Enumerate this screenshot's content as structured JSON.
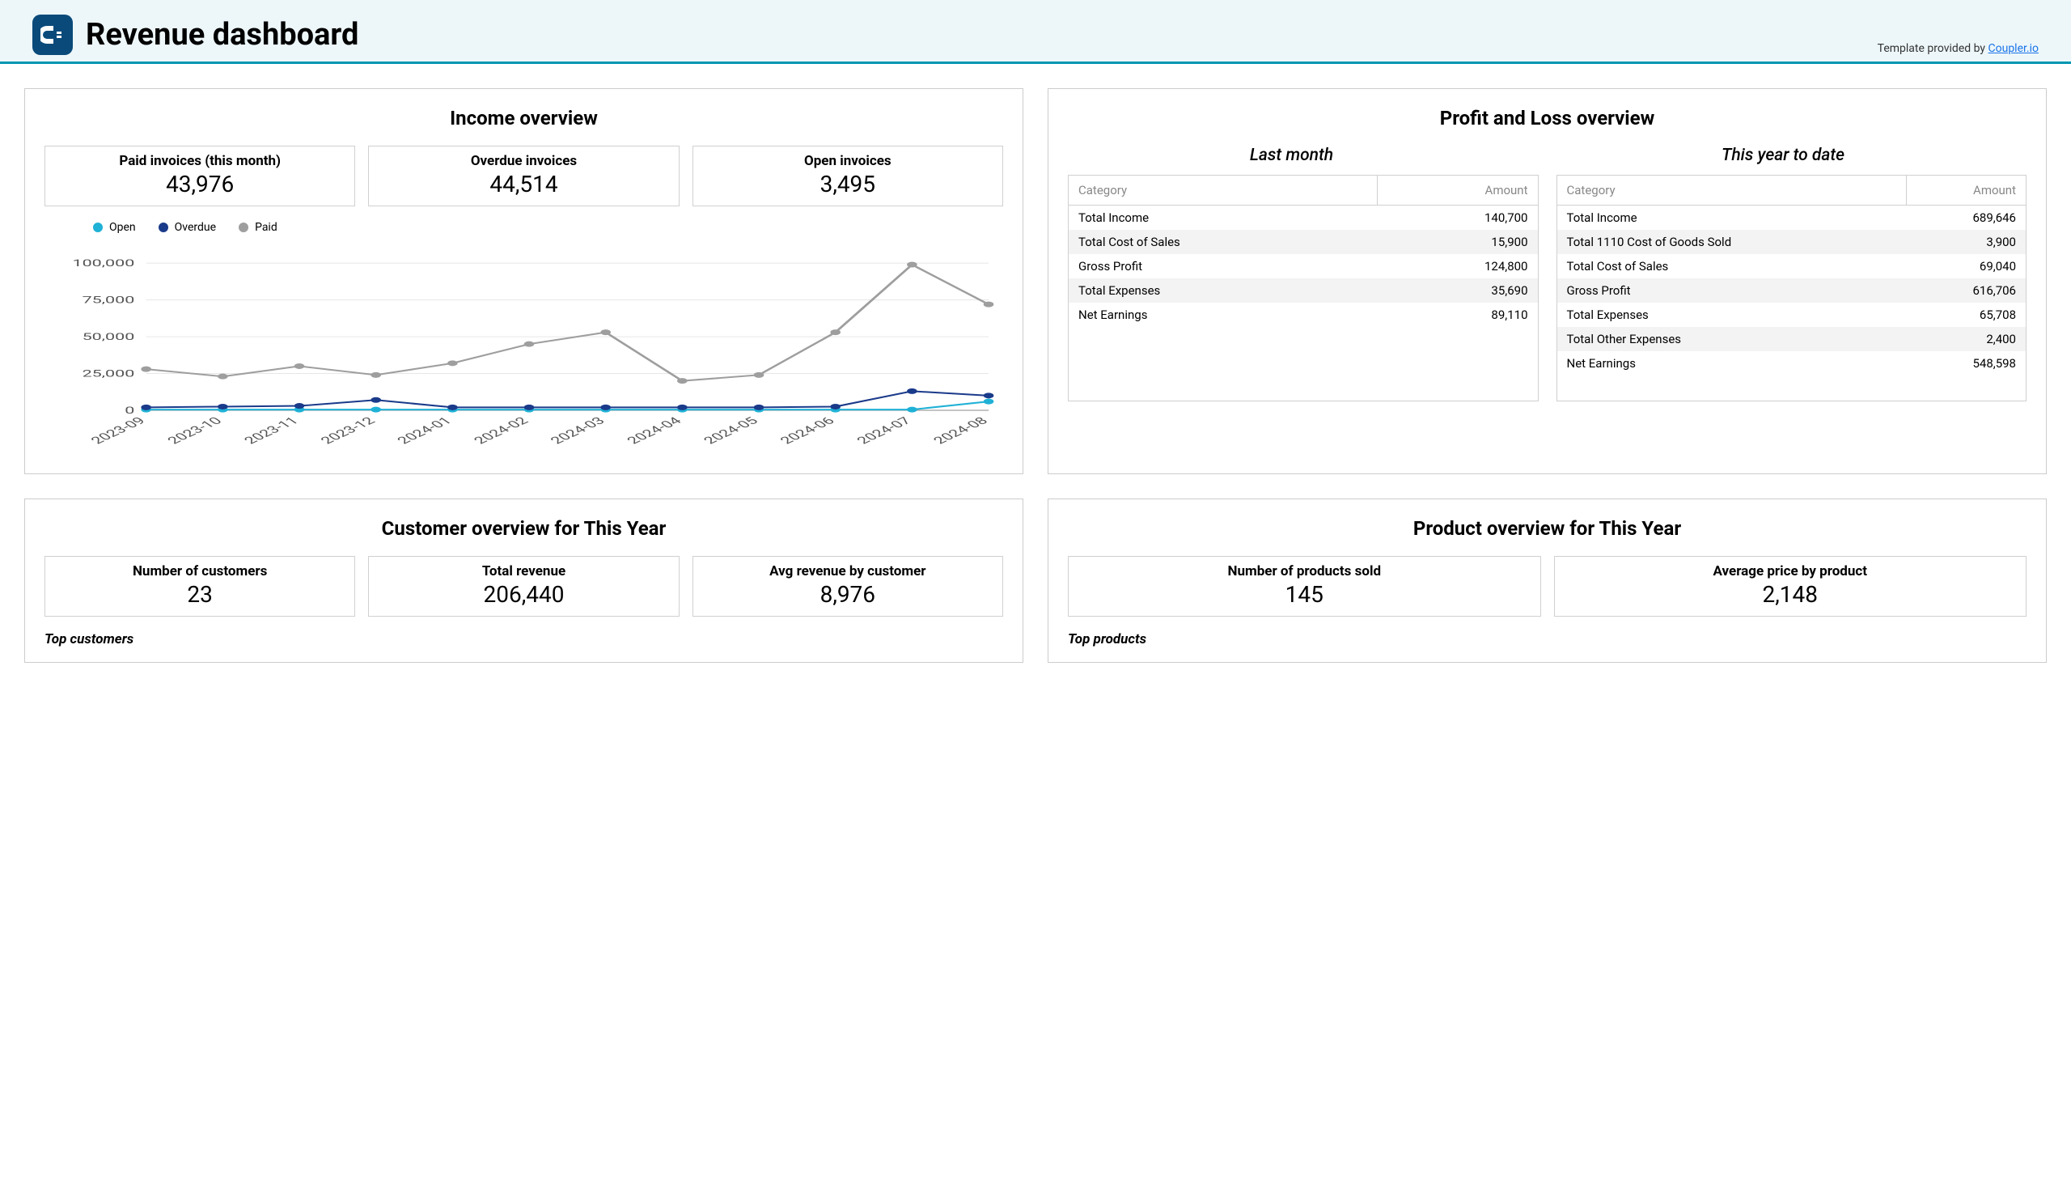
{
  "header": {
    "title": "Revenue dashboard",
    "template_text": "Template provided by ",
    "template_link": "Coupler.io"
  },
  "income": {
    "title": "Income overview",
    "stats": [
      {
        "label": "Paid invoices (this month)",
        "value": "43,976"
      },
      {
        "label": "Overdue invoices",
        "value": "44,514"
      },
      {
        "label": "Open invoices",
        "value": "3,495"
      }
    ],
    "legend": {
      "open": "Open",
      "overdue": "Overdue",
      "paid": "Paid"
    }
  },
  "chart_data": {
    "type": "line",
    "title": "Income overview",
    "xlabel": "",
    "ylabel": "",
    "ylim": [
      0,
      110000
    ],
    "yticks": [
      0,
      25000,
      50000,
      75000,
      100000
    ],
    "ytick_labels": [
      "0",
      "25,000",
      "50,000",
      "75,000",
      "100,000"
    ],
    "categories": [
      "2023-09",
      "2023-10",
      "2023-11",
      "2023-12",
      "2024-01",
      "2024-02",
      "2024-03",
      "2024-04",
      "2024-05",
      "2024-06",
      "2024-07",
      "2024-08"
    ],
    "series": [
      {
        "name": "Open",
        "color": "#1fb1d6",
        "values": [
          500,
          500,
          500,
          500,
          500,
          500,
          500,
          500,
          500,
          500,
          500,
          6000
        ]
      },
      {
        "name": "Overdue",
        "color": "#1a3a8a",
        "values": [
          2000,
          2500,
          3000,
          7000,
          2000,
          2000,
          2000,
          2000,
          2000,
          2500,
          13000,
          10000
        ]
      },
      {
        "name": "Paid",
        "color": "#9e9e9e",
        "values": [
          28000,
          23000,
          30000,
          24000,
          32000,
          45000,
          53000,
          20000,
          24000,
          53000,
          99000,
          72000
        ]
      }
    ]
  },
  "profit_loss": {
    "title": "Profit and Loss overview",
    "last_month_label": "Last month",
    "ytd_label": "This year to date",
    "col_category": "Category",
    "col_amount": "Amount",
    "last_month": [
      {
        "category": "Total Income",
        "amount": "140,700"
      },
      {
        "category": "Total Cost of Sales",
        "amount": "15,900"
      },
      {
        "category": "Gross Profit",
        "amount": "124,800"
      },
      {
        "category": "Total Expenses",
        "amount": "35,690"
      },
      {
        "category": "Net Earnings",
        "amount": "89,110"
      }
    ],
    "ytd": [
      {
        "category": "Total Income",
        "amount": "689,646"
      },
      {
        "category": "Total 1110 Cost of Goods Sold",
        "amount": "3,900"
      },
      {
        "category": "Total Cost of Sales",
        "amount": "69,040"
      },
      {
        "category": "Gross Profit",
        "amount": "616,706"
      },
      {
        "category": "Total Expenses",
        "amount": "65,708"
      },
      {
        "category": "Total Other Expenses",
        "amount": "2,400"
      },
      {
        "category": "Net Earnings",
        "amount": "548,598"
      }
    ]
  },
  "customer": {
    "title": "Customer overview for This Year",
    "stats": [
      {
        "label": "Number of customers",
        "value": "23"
      },
      {
        "label": "Total revenue",
        "value": "206,440"
      },
      {
        "label": "Avg revenue by customer",
        "value": "8,976"
      }
    ],
    "top_customers_label": "Top customers"
  },
  "product": {
    "title": "Product overview for This Year",
    "stats": [
      {
        "label": "Number of products sold",
        "value": "145"
      },
      {
        "label": "Average price by product",
        "value": "2,148"
      }
    ],
    "top_products_label": "Top products"
  }
}
